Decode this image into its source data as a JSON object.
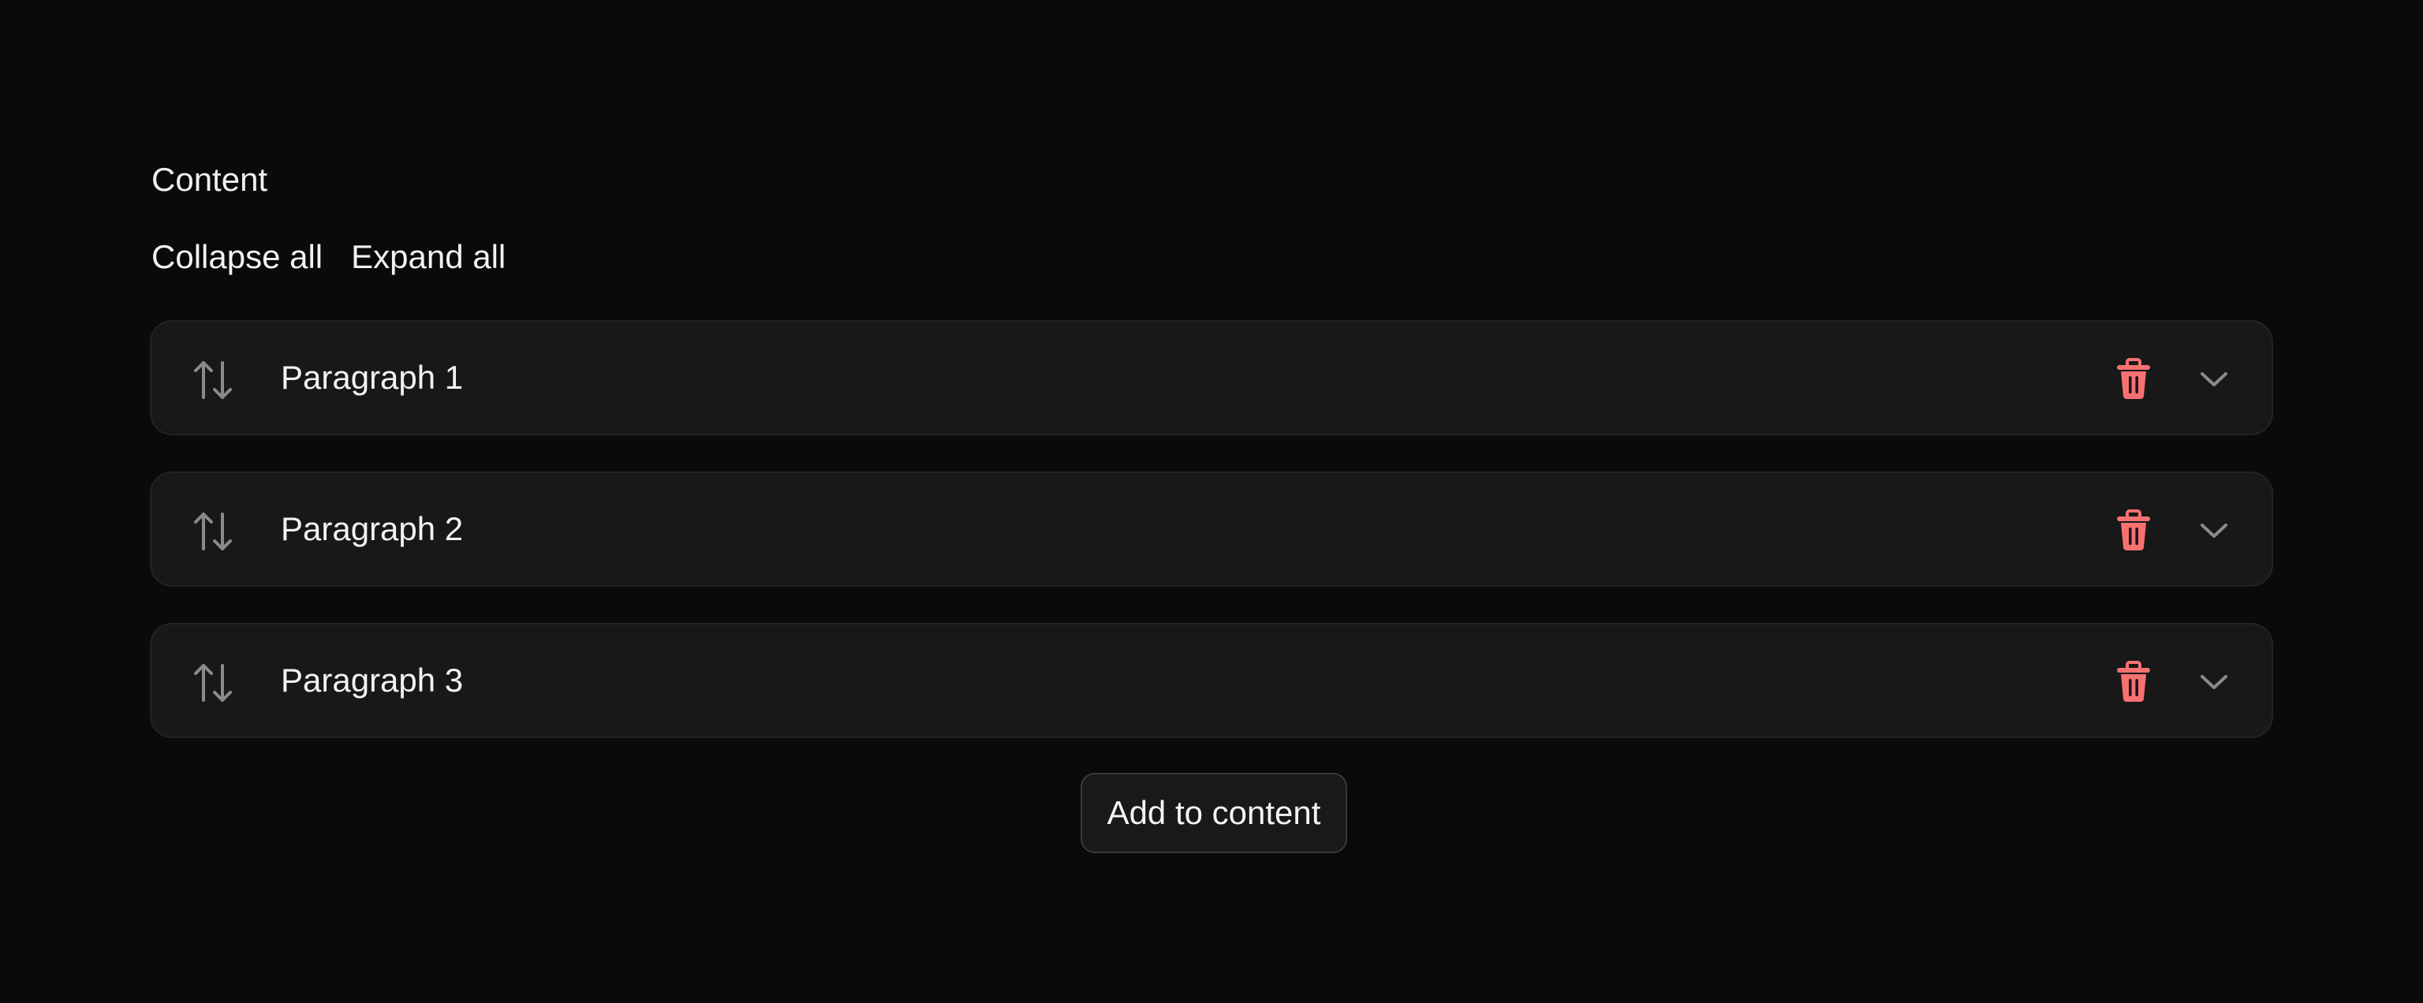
{
  "section": {
    "label": "Content"
  },
  "toolbar": {
    "collapse_all": "Collapse all",
    "expand_all": "Expand all"
  },
  "blocks": [
    {
      "title": "Paragraph 1",
      "drag_icon": "arrows-up-down-icon",
      "delete_icon": "trash-icon",
      "toggle_icon": "chevron-down-icon"
    },
    {
      "title": "Paragraph 2",
      "drag_icon": "arrows-up-down-icon",
      "delete_icon": "trash-icon",
      "toggle_icon": "chevron-down-icon"
    },
    {
      "title": "Paragraph 3",
      "drag_icon": "arrows-up-down-icon",
      "delete_icon": "trash-icon",
      "toggle_icon": "chevron-down-icon"
    }
  ],
  "add_button": {
    "label": "Add to content"
  },
  "colors": {
    "background": "#0a0a0c",
    "row_background": "#181818",
    "danger": "#f87171",
    "muted_icon": "#8a8a8e"
  }
}
